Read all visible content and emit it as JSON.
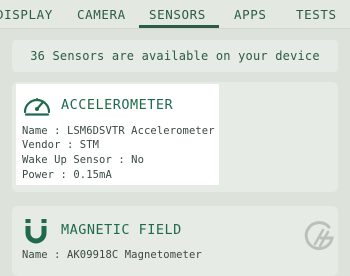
{
  "tabs": [
    {
      "label": "DISPLAY"
    },
    {
      "label": "CAMERA"
    },
    {
      "label": "SENSORS",
      "active": true
    },
    {
      "label": "APPS"
    },
    {
      "label": "TESTS"
    }
  ],
  "banner": "36 Sensors are available on your device",
  "sensors": [
    {
      "title": "ACCELEROMETER",
      "icon": "gauge-icon",
      "details": [
        "Name : LSM6DSVTR Accelerometer",
        "Vendor : STM",
        "Wake Up Sensor : No",
        "Power : 0.15mA"
      ]
    },
    {
      "title": "MAGNETIC FIELD",
      "icon": "magnet-icon",
      "details": [
        "Name : AK09918C Magnetometer"
      ]
    }
  ],
  "colors": {
    "accent": "#1f6a4d",
    "background": "#dde3db",
    "card": "#e7ebe5"
  },
  "fab_icon": "app-logo-icon"
}
